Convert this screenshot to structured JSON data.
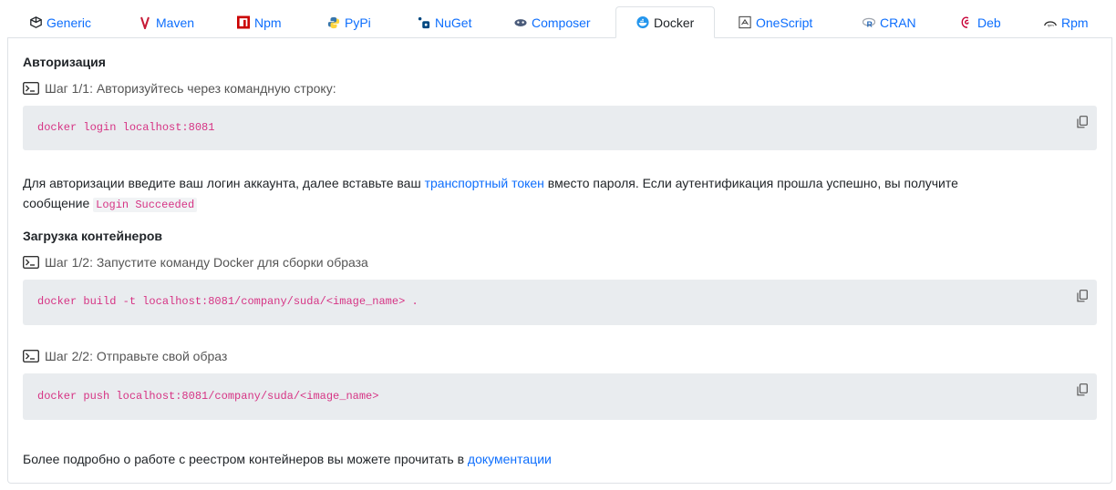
{
  "tabs": [
    {
      "label": "Generic",
      "icon": "box-icon"
    },
    {
      "label": "Maven",
      "icon": "maven-icon"
    },
    {
      "label": "Npm",
      "icon": "npm-icon"
    },
    {
      "label": "PyPi",
      "icon": "python-icon"
    },
    {
      "label": "NuGet",
      "icon": "nuget-icon"
    },
    {
      "label": "Composer",
      "icon": "composer-icon"
    },
    {
      "label": "Docker",
      "icon": "docker-icon",
      "active": true
    },
    {
      "label": "OneScript",
      "icon": "onescript-icon"
    },
    {
      "label": "CRAN",
      "icon": "r-icon"
    },
    {
      "label": "Deb",
      "icon": "debian-icon"
    },
    {
      "label": "Rpm",
      "icon": "rpm-icon"
    }
  ],
  "auth": {
    "heading": "Авторизация",
    "step": "Шаг 1/1: Авторизуйтесь через командную строку:",
    "command": "docker login localhost:8081",
    "desc_before": "Для авторизации введите ваш логин аккаунта, далее вставьте ваш ",
    "desc_link": "транспортный токен",
    "desc_after": " вместо пароля. Если аутентификация прошла успешно, вы получите",
    "desc_line2": "сообщение ",
    "success_code": "Login Succeeded"
  },
  "upload": {
    "heading": "Загрузка контейнеров",
    "step1": "Шаг 1/2: Запустите команду Docker для сборки образа",
    "command1": "docker build -t localhost:8081/company/suda/<image_name> .",
    "step2": "Шаг 2/2: Отправьте свой образ",
    "command2": "docker push localhost:8081/company/suda/<image_name>"
  },
  "footer": {
    "text": "Более подробно о работе с реестром контейнеров вы можете прочитать в ",
    "link": "документации"
  },
  "colors": {
    "accent": "#0d6efd",
    "code": "#d63384",
    "code_bg": "#e9ecef"
  }
}
